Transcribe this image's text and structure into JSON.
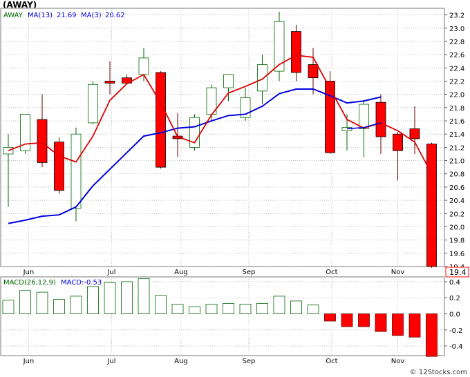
{
  "header": {
    "title": "(AWAY)"
  },
  "credit": "© 12Stocks.com",
  "colors": {
    "up_fill": "#ffffff",
    "up_stroke": "#006600",
    "down_fill": "#ff0000",
    "down_stroke": "#000000",
    "ma13": "#0000dd",
    "ma3": "#dd0000",
    "bg": "#ffffff",
    "grid": "#999999"
  },
  "chart_data": [
    {
      "type": "candlestick",
      "legend": {
        "ticker": "AWAY",
        "ma13_label": "MA(13)",
        "ma13_value": "21.69",
        "ma3_label": "MA(3)",
        "ma3_value": "20.62"
      },
      "y_ticks": [
        "23.2",
        "23.0",
        "22.8",
        "22.6",
        "22.4",
        "22.2",
        "22.0",
        "21.8",
        "21.6",
        "21.4",
        "21.2",
        "21.0",
        "20.8",
        "20.6",
        "20.4",
        "20.2",
        "20.0",
        "19.8",
        "19.6",
        "19.4"
      ],
      "ylim": [
        19.4,
        23.3
      ],
      "last_price": "19.4",
      "x_labels": [
        {
          "label": "Jun",
          "pos": 1.2
        },
        {
          "label": "Jul",
          "pos": 6.1
        },
        {
          "label": "Aug",
          "pos": 10.2
        },
        {
          "label": "Sep",
          "pos": 14.2
        },
        {
          "label": "Oct",
          "pos": 19.1
        },
        {
          "label": "Nov",
          "pos": 23.0
        }
      ],
      "candles": [
        {
          "o": 21.1,
          "h": 21.4,
          "l": 20.3,
          "c": 21.2
        },
        {
          "o": 21.15,
          "h": 21.7,
          "l": 21.1,
          "c": 21.7
        },
        {
          "o": 21.62,
          "h": 22.0,
          "l": 20.9,
          "c": 20.97
        },
        {
          "o": 21.28,
          "h": 21.35,
          "l": 20.5,
          "c": 20.55
        },
        {
          "o": 20.28,
          "h": 21.5,
          "l": 20.08,
          "c": 21.4
        },
        {
          "o": 21.57,
          "h": 22.2,
          "l": 21.55,
          "c": 22.15
        },
        {
          "o": 22.2,
          "h": 22.5,
          "l": 22.0,
          "c": 22.17
        },
        {
          "o": 22.25,
          "h": 22.3,
          "l": 22.15,
          "c": 22.17
        },
        {
          "o": 22.3,
          "h": 22.7,
          "l": 22.2,
          "c": 22.55
        },
        {
          "o": 22.33,
          "h": 22.35,
          "l": 20.88,
          "c": 20.9
        },
        {
          "o": 21.37,
          "h": 21.72,
          "l": 21.05,
          "c": 21.33
        },
        {
          "o": 21.2,
          "h": 21.7,
          "l": 21.15,
          "c": 21.65
        },
        {
          "o": 21.7,
          "h": 22.15,
          "l": 21.6,
          "c": 22.1
        },
        {
          "o": 22.1,
          "h": 22.3,
          "l": 21.9,
          "c": 22.3
        },
        {
          "o": 21.65,
          "h": 22.1,
          "l": 21.6,
          "c": 21.95
        },
        {
          "o": 22.05,
          "h": 22.6,
          "l": 21.85,
          "c": 22.45
        },
        {
          "o": 22.35,
          "h": 23.25,
          "l": 22.2,
          "c": 23.1
        },
        {
          "o": 22.95,
          "h": 23.05,
          "l": 22.2,
          "c": 22.33
        },
        {
          "o": 22.45,
          "h": 22.7,
          "l": 22.0,
          "c": 22.25
        },
        {
          "o": 22.2,
          "h": 22.35,
          "l": 21.1,
          "c": 21.12
        },
        {
          "o": 21.45,
          "h": 21.7,
          "l": 21.15,
          "c": 21.5
        },
        {
          "o": 21.48,
          "h": 21.9,
          "l": 21.05,
          "c": 21.85
        },
        {
          "o": 21.88,
          "h": 22.0,
          "l": 21.1,
          "c": 21.36
        },
        {
          "o": 21.4,
          "h": 21.43,
          "l": 20.7,
          "c": 21.15
        },
        {
          "o": 21.48,
          "h": 21.82,
          "l": 21.1,
          "c": 21.33
        },
        {
          "o": 21.25,
          "h": 21.27,
          "l": 19.38,
          "c": 19.4
        }
      ],
      "ma13": [
        {
          "i": 0,
          "v": 20.05
        },
        {
          "i": 1,
          "v": 20.1
        },
        {
          "i": 2,
          "v": 20.16
        },
        {
          "i": 3,
          "v": 20.18
        },
        {
          "i": 4,
          "v": 20.3
        },
        {
          "i": 5,
          "v": 20.62
        },
        {
          "i": 6,
          "v": 20.87
        },
        {
          "i": 7,
          "v": 21.12
        },
        {
          "i": 8,
          "v": 21.37
        },
        {
          "i": 9,
          "v": 21.42
        },
        {
          "i": 10,
          "v": 21.49
        },
        {
          "i": 11,
          "v": 21.51
        },
        {
          "i": 12,
          "v": 21.6
        },
        {
          "i": 13,
          "v": 21.68
        },
        {
          "i": 14,
          "v": 21.7
        },
        {
          "i": 15,
          "v": 21.82
        },
        {
          "i": 16,
          "v": 22.01
        },
        {
          "i": 17,
          "v": 22.08
        },
        {
          "i": 18,
          "v": 22.08
        },
        {
          "i": 19,
          "v": 21.98
        },
        {
          "i": 20,
          "v": 21.87
        },
        {
          "i": 21,
          "v": 21.9
        },
        {
          "i": 22,
          "v": 21.96
        }
      ],
      "ma3": [
        {
          "i": 0,
          "v": 21.15
        },
        {
          "i": 1,
          "v": 21.25
        },
        {
          "i": 2,
          "v": 21.27
        },
        {
          "i": 3,
          "v": 21.07
        },
        {
          "i": 4,
          "v": 20.98
        },
        {
          "i": 5,
          "v": 21.37
        },
        {
          "i": 6,
          "v": 21.91
        },
        {
          "i": 7,
          "v": 22.16
        },
        {
          "i": 8,
          "v": 22.3
        },
        {
          "i": 9,
          "v": 21.87
        },
        {
          "i": 10,
          "v": 21.36
        },
        {
          "i": 11,
          "v": 21.27
        },
        {
          "i": 12,
          "v": 21.69
        },
        {
          "i": 13,
          "v": 22.02
        },
        {
          "i": 14,
          "v": 22.12
        },
        {
          "i": 15,
          "v": 22.23
        },
        {
          "i": 16,
          "v": 22.45
        },
        {
          "i": 17,
          "v": 22.59
        },
        {
          "i": 18,
          "v": 22.56
        },
        {
          "i": 19,
          "v": 22.09
        },
        {
          "i": 20,
          "v": 21.62
        },
        {
          "i": 21,
          "v": 21.49
        },
        {
          "i": 22,
          "v": 21.57
        },
        {
          "i": 23,
          "v": 21.45
        },
        {
          "i": 24,
          "v": 21.28
        },
        {
          "i": 25,
          "v": 20.8
        }
      ],
      "ma3_blue_tail": [
        {
          "i": 20,
          "v": 21.48
        },
        {
          "i": 21,
          "v": 21.5
        },
        {
          "i": 22,
          "v": 21.57
        }
      ]
    },
    {
      "type": "bar",
      "legend": {
        "label": "MACD(26,12,9)",
        "value_label": "MACD:-0.53"
      },
      "y_ticks": [
        "0.4",
        "0.2",
        "0.0",
        "-0.2",
        "-0.4"
      ],
      "ylim": [
        -0.52,
        0.46
      ],
      "values": [
        0.17,
        0.29,
        0.27,
        0.18,
        0.22,
        0.34,
        0.39,
        0.4,
        0.44,
        0.23,
        0.12,
        0.09,
        0.12,
        0.13,
        0.12,
        0.13,
        0.22,
        0.16,
        0.11,
        -0.09,
        -0.16,
        -0.16,
        -0.22,
        -0.27,
        -0.29,
        -0.53
      ]
    }
  ]
}
